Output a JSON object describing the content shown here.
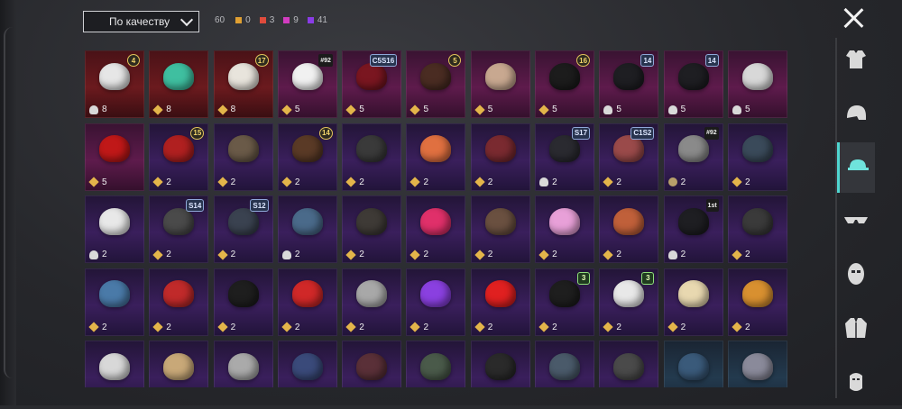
{
  "sort": {
    "label": "По качеству"
  },
  "counts": {
    "total": "60",
    "items": [
      {
        "color": "#e0a032",
        "value": "0"
      },
      {
        "color": "#e04b3c",
        "value": "3"
      },
      {
        "color": "#d23cc0",
        "value": "9"
      },
      {
        "color": "#8a3ce6",
        "value": "41"
      }
    ]
  },
  "categories": [
    "outfit-icon",
    "helmet-icon",
    "hat-icon",
    "glasses-icon",
    "mask-icon",
    "jacket-icon",
    "face-paint-icon"
  ],
  "active_category": 2,
  "tiles": [
    {
      "rarity": "red",
      "qicon": "cloud",
      "qty": "8",
      "badge": "4",
      "badge_type": "lvl",
      "art": "#e6e6e6"
    },
    {
      "rarity": "red",
      "qicon": "gold",
      "qty": "8",
      "badge": "",
      "badge_type": "",
      "art": "#3fbfa0"
    },
    {
      "rarity": "red",
      "qicon": "gold",
      "qty": "8",
      "badge": "17",
      "badge_type": "lvl",
      "art": "#e8e4dc"
    },
    {
      "rarity": "pink",
      "qicon": "gold",
      "qty": "5",
      "badge": "#92",
      "badge_type": "tag",
      "art": "#f1f1f1"
    },
    {
      "rarity": "pink",
      "qicon": "gold",
      "qty": "5",
      "badge": "C5S16",
      "badge_type": "season",
      "art": "#7a1620"
    },
    {
      "rarity": "pink",
      "qicon": "gold",
      "qty": "5",
      "badge": "5",
      "badge_type": "lvl",
      "art": "#4a2c22"
    },
    {
      "rarity": "pink",
      "qicon": "gold",
      "qty": "5",
      "badge": "",
      "badge_type": "",
      "art": "#c8a890"
    },
    {
      "rarity": "pink",
      "qicon": "gold",
      "qty": "5",
      "badge": "16",
      "badge_type": "lvl",
      "art": "#1c1c1c"
    },
    {
      "rarity": "pink",
      "qicon": "cloud",
      "qty": "5",
      "badge": "14",
      "badge_type": "season",
      "art": "#1e1e22"
    },
    {
      "rarity": "pink",
      "qicon": "cloud",
      "qty": "5",
      "badge": "14",
      "badge_type": "season",
      "art": "#1e1e22"
    },
    {
      "rarity": "pink",
      "qicon": "cloud",
      "qty": "5",
      "badge": "",
      "badge_type": "",
      "art": "#d8d8d8"
    },
    {
      "rarity": "pink",
      "qicon": "gold",
      "qty": "5",
      "badge": "",
      "badge_type": "",
      "art": "#c01818"
    },
    {
      "rarity": "purple",
      "qicon": "gold",
      "qty": "2",
      "badge": "15",
      "badge_type": "lvl",
      "art": "#b02020"
    },
    {
      "rarity": "purple",
      "qicon": "gold",
      "qty": "2",
      "badge": "",
      "badge_type": "",
      "art": "#6a5a48"
    },
    {
      "rarity": "purple",
      "qicon": "gold",
      "qty": "2",
      "badge": "14",
      "badge_type": "lvl",
      "art": "#5a3a26"
    },
    {
      "rarity": "purple",
      "qicon": "gold",
      "qty": "2",
      "badge": "",
      "badge_type": "",
      "art": "#3a3a3a"
    },
    {
      "rarity": "purple",
      "qicon": "gold",
      "qty": "2",
      "badge": "",
      "badge_type": "",
      "art": "#e07040"
    },
    {
      "rarity": "purple",
      "qicon": "gold",
      "qty": "2",
      "badge": "",
      "badge_type": "",
      "art": "#7a2a30"
    },
    {
      "rarity": "purple",
      "qicon": "cloud",
      "qty": "2",
      "badge": "S17",
      "badge_type": "season",
      "art": "#2a2a30"
    },
    {
      "rarity": "purple",
      "qicon": "gold",
      "qty": "2",
      "badge": "C1S2",
      "badge_type": "season",
      "art": "#9a4a4a"
    },
    {
      "rarity": "purple",
      "qicon": "coin",
      "qty": "2",
      "badge": "#92",
      "badge_type": "tag",
      "art": "#8a8a8a"
    },
    {
      "rarity": "purple",
      "qicon": "gold",
      "qty": "2",
      "badge": "",
      "badge_type": "",
      "art": "#3a4a5a"
    },
    {
      "rarity": "purple",
      "qicon": "cloud",
      "qty": "2",
      "badge": "",
      "badge_type": "",
      "art": "#e8e8e8"
    },
    {
      "rarity": "purple",
      "qicon": "gold",
      "qty": "2",
      "badge": "S14",
      "badge_type": "season",
      "art": "#4a4a4a"
    },
    {
      "rarity": "purple",
      "qicon": "gold",
      "qty": "2",
      "badge": "S12",
      "badge_type": "season",
      "art": "#3a4250"
    },
    {
      "rarity": "purple",
      "qicon": "cloud",
      "qty": "2",
      "badge": "",
      "badge_type": "",
      "art": "#4a6a8a"
    },
    {
      "rarity": "purple",
      "qicon": "gold",
      "qty": "2",
      "badge": "",
      "badge_type": "",
      "art": "#3e3a36"
    },
    {
      "rarity": "purple",
      "qicon": "gold",
      "qty": "2",
      "badge": "",
      "badge_type": "",
      "art": "#e0306a"
    },
    {
      "rarity": "purple",
      "qicon": "gold",
      "qty": "2",
      "badge": "",
      "badge_type": "",
      "art": "#6a5040"
    },
    {
      "rarity": "purple",
      "qicon": "gold",
      "qty": "2",
      "badge": "",
      "badge_type": "",
      "art": "#e8a0d8"
    },
    {
      "rarity": "purple",
      "qicon": "gold",
      "qty": "2",
      "badge": "",
      "badge_type": "",
      "art": "#c0603a"
    },
    {
      "rarity": "purple",
      "qicon": "cloud",
      "qty": "2",
      "badge": "1st",
      "badge_type": "tag",
      "art": "#1e1e22"
    },
    {
      "rarity": "purple",
      "qicon": "gold",
      "qty": "2",
      "badge": "",
      "badge_type": "",
      "art": "#3a3a3a"
    },
    {
      "rarity": "purple",
      "qicon": "gold",
      "qty": "2",
      "badge": "",
      "badge_type": "",
      "art": "#4a7aa8"
    },
    {
      "rarity": "purple",
      "qicon": "gold",
      "qty": "2",
      "badge": "",
      "badge_type": "",
      "art": "#c02a2a"
    },
    {
      "rarity": "purple",
      "qicon": "gold",
      "qty": "2",
      "badge": "",
      "badge_type": "",
      "art": "#1e1e1e"
    },
    {
      "rarity": "purple",
      "qicon": "gold",
      "qty": "2",
      "badge": "",
      "badge_type": "",
      "art": "#d02828"
    },
    {
      "rarity": "purple",
      "qicon": "gold",
      "qty": "2",
      "badge": "",
      "badge_type": "",
      "art": "#a8a8a8"
    },
    {
      "rarity": "purple",
      "qicon": "gold",
      "qty": "2",
      "badge": "",
      "badge_type": "",
      "art": "#8a40e0"
    },
    {
      "rarity": "purple",
      "qicon": "gold",
      "qty": "2",
      "badge": "",
      "badge_type": "",
      "art": "#e02020"
    },
    {
      "rarity": "purple",
      "qicon": "gold",
      "qty": "2",
      "badge": "3",
      "badge_type": "rank",
      "art": "#1e1e1e"
    },
    {
      "rarity": "purple",
      "qicon": "gold",
      "qty": "2",
      "badge": "3",
      "badge_type": "rank",
      "art": "#e8e8e8"
    },
    {
      "rarity": "purple",
      "qicon": "gold",
      "qty": "2",
      "badge": "",
      "badge_type": "",
      "art": "#e8d8b0"
    },
    {
      "rarity": "purple",
      "qicon": "gold",
      "qty": "2",
      "badge": "",
      "badge_type": "",
      "art": "#d89030"
    },
    {
      "rarity": "purple",
      "qicon": "gold",
      "qty": "",
      "badge": "",
      "badge_type": "",
      "art": "#d8d8d8"
    },
    {
      "rarity": "purple",
      "qicon": "gold",
      "qty": "",
      "badge": "",
      "badge_type": "",
      "art": "#c8a878"
    },
    {
      "rarity": "purple",
      "qicon": "gold",
      "qty": "",
      "badge": "",
      "badge_type": "",
      "art": "#aaaaaa"
    },
    {
      "rarity": "purple",
      "qicon": "gold",
      "qty": "",
      "badge": "",
      "badge_type": "",
      "art": "#3a4a7a"
    },
    {
      "rarity": "purple",
      "qicon": "gold",
      "qty": "",
      "badge": "",
      "badge_type": "",
      "art": "#5a3038"
    },
    {
      "rarity": "purple",
      "qicon": "gold",
      "qty": "",
      "badge": "",
      "badge_type": "",
      "art": "#4a5a4a"
    },
    {
      "rarity": "purple",
      "qicon": "gold",
      "qty": "",
      "badge": "",
      "badge_type": "",
      "art": "#2a2a2a"
    },
    {
      "rarity": "purple",
      "qicon": "gold",
      "qty": "",
      "badge": "",
      "badge_type": "",
      "art": "#4a5a6a"
    },
    {
      "rarity": "purple",
      "qicon": "gold",
      "qty": "",
      "badge": "",
      "badge_type": "",
      "art": "#4a4a4a"
    },
    {
      "rarity": "teal",
      "qicon": "gold",
      "qty": "",
      "badge": "",
      "badge_type": "",
      "art": "#3a5a7a"
    },
    {
      "rarity": "teal",
      "qicon": "gold",
      "qty": "",
      "badge": "",
      "badge_type": "",
      "art": "#8a8a9a"
    }
  ]
}
